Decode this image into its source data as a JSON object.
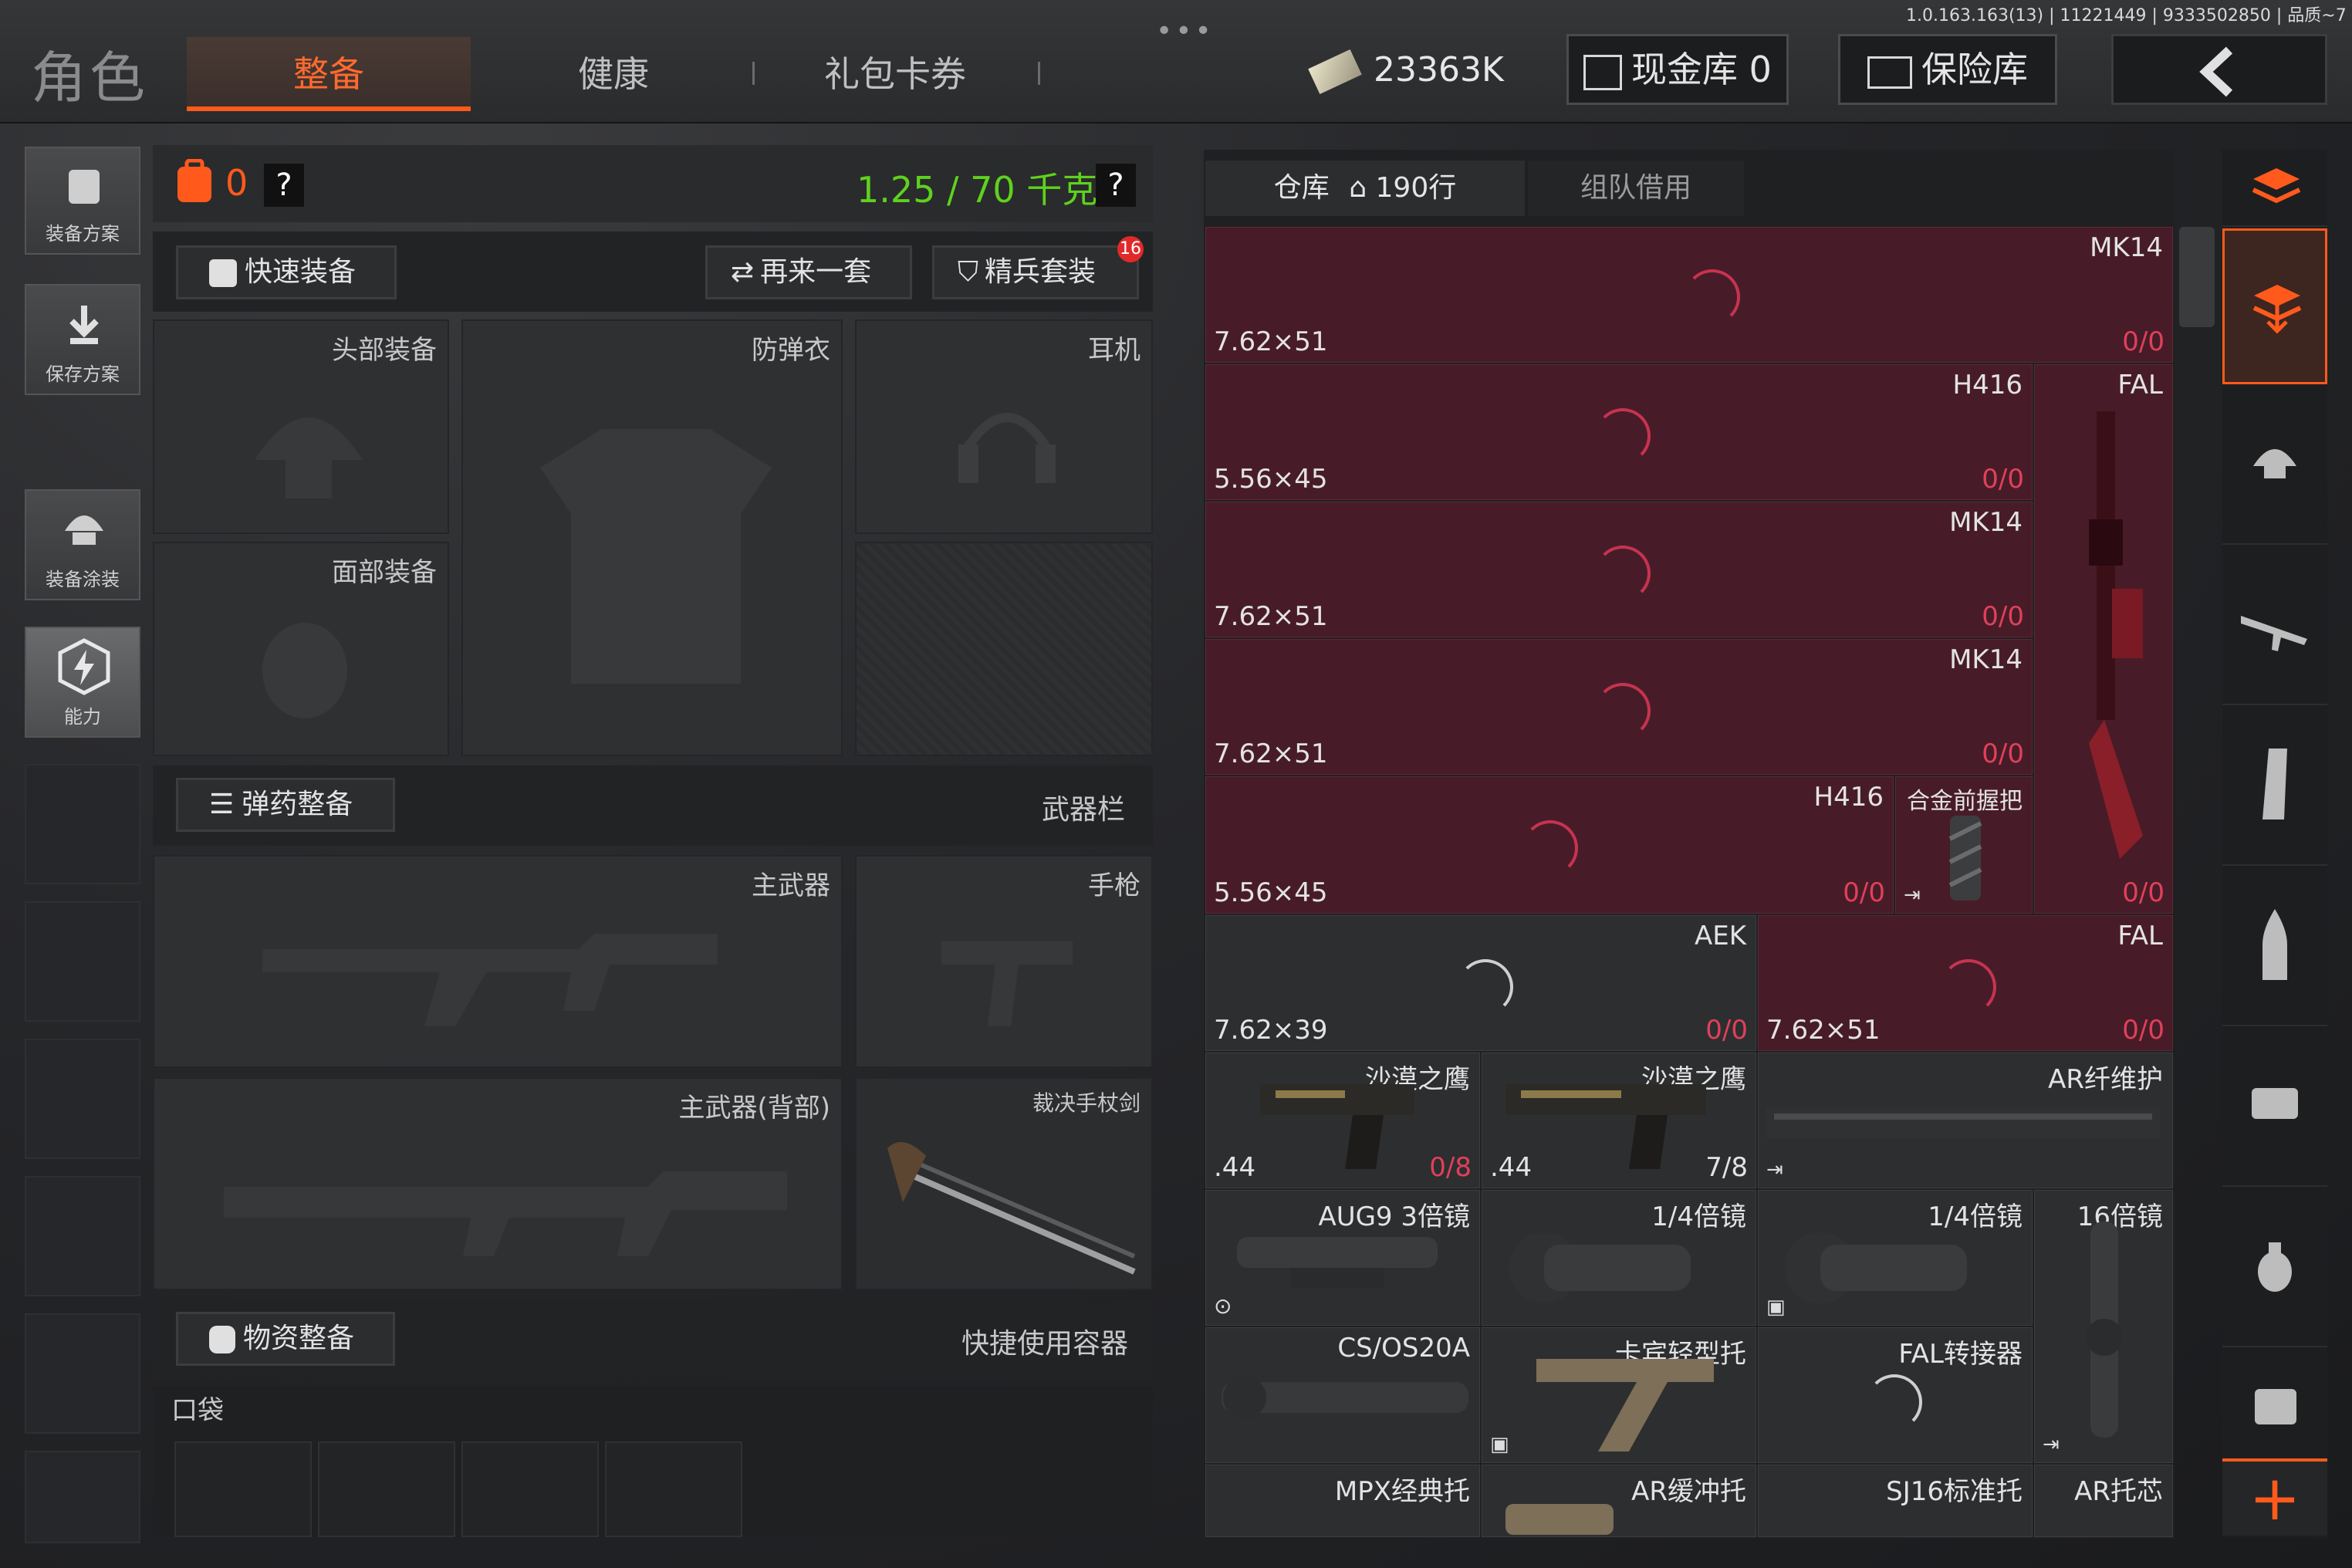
{
  "top": {
    "role": "角色",
    "tabs": [
      "整备",
      "健康",
      "礼包卡券"
    ],
    "active_tab": "整备",
    "version": "1.0.163.163(13) | 11221449 | 9333502850 | 品质~7",
    "money": "23363K",
    "cash_vault": "现金库 0",
    "safe": "保险库"
  },
  "sidebar": {
    "items": [
      "装备方案",
      "保存方案",
      "装备涂装",
      "能力"
    ]
  },
  "equip": {
    "backpack_count": "0",
    "help": "?",
    "weight": "1.25 / 70 千克",
    "quick_equip": "快速装备",
    "again": "再来一套",
    "elite": "精兵套装",
    "elite_badge": "16",
    "slots": {
      "head": "头部装备",
      "armor": "防弹衣",
      "headset": "耳机",
      "face": "面部装备",
      "primary": "主武器",
      "pistol": "手枪",
      "primary_back": "主武器(背部)",
      "melee": "裁决手杖剑"
    },
    "ammo_btn": "弹药整备",
    "weapon_bar": "武器栏",
    "supply_btn": "物资整备",
    "quick_container": "快捷使用容器",
    "pocket": "口袋"
  },
  "storage": {
    "tab_warehouse": "仓库",
    "rows": "190行",
    "tab_team": "组队借用",
    "cells": [
      {
        "name": "MK14",
        "cal": "7.62×51",
        "count": "0/0"
      },
      {
        "name": "H416",
        "cal": "5.56×45",
        "count": "0/0"
      },
      {
        "name": "FAL",
        "cal": "",
        "count": "0/0"
      },
      {
        "name": "MK14",
        "cal": "7.62×51",
        "count": "0/0"
      },
      {
        "name": "MK14",
        "cal": "7.62×51",
        "count": "0/0"
      },
      {
        "name": "H416",
        "cal": "5.56×45",
        "count": "0/0"
      },
      {
        "name": "合金前握把",
        "cal": "",
        "count": ""
      },
      {
        "name": "AEK",
        "cal": "7.62×39",
        "count": "0/0"
      },
      {
        "name": "FAL",
        "cal": "7.62×51",
        "count": "0/0"
      },
      {
        "name": "沙漠之鹰",
        "cal": ".44",
        "count": "0/8"
      },
      {
        "name": "沙漠之鹰",
        "cal": ".44",
        "count": "7/8"
      },
      {
        "name": "AR纤维护",
        "cal": "",
        "count": ""
      },
      {
        "name": "AUG9 3倍镜",
        "cal": "",
        "count": ""
      },
      {
        "name": "1/4倍镜",
        "cal": "",
        "count": ""
      },
      {
        "name": "1/4倍镜",
        "cal": "",
        "count": ""
      },
      {
        "name": "16倍镜",
        "cal": "",
        "count": ""
      },
      {
        "name": "CS/OS20A",
        "cal": "",
        "count": ""
      },
      {
        "name": "卡宾轻型托",
        "cal": "",
        "count": ""
      },
      {
        "name": "FAL转接器",
        "cal": "",
        "count": ""
      },
      {
        "name": "MPX经典托",
        "cal": "",
        "count": ""
      },
      {
        "name": "AR缓冲托",
        "cal": "",
        "count": ""
      },
      {
        "name": "SJ16标准托",
        "cal": "",
        "count": ""
      },
      {
        "name": "AR托芯",
        "cal": "",
        "count": ""
      }
    ]
  },
  "colors": {
    "accent": "#ff5a1c",
    "weight_green": "#5ed21c",
    "cell_red": "#471c28",
    "count_red": "#e0405a"
  }
}
